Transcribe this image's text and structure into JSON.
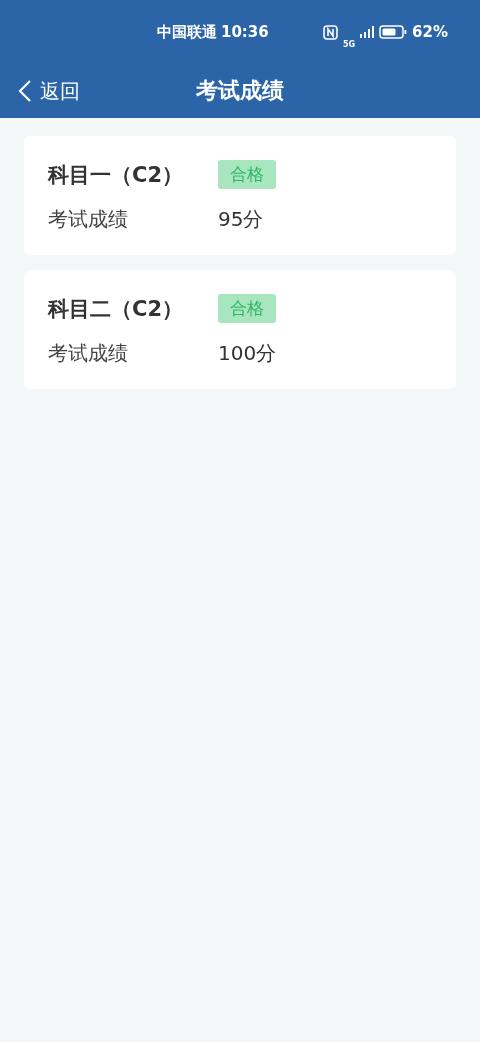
{
  "status_bar": {
    "carrier": "中国联通",
    "time": "10:36",
    "network": "5G",
    "battery": "62%"
  },
  "nav": {
    "back": "返回",
    "title": "考试成绩"
  },
  "cards": [
    {
      "subject": "科目一（C2）",
      "badge": {
        "label": "合格",
        "kind": "pass"
      },
      "label": "考试成绩",
      "score": "95分"
    },
    {
      "subject": "科目二（C2）",
      "badge": {
        "label": "合格",
        "kind": "pass"
      },
      "label": "考试成绩",
      "score": "100分"
    }
  ]
}
